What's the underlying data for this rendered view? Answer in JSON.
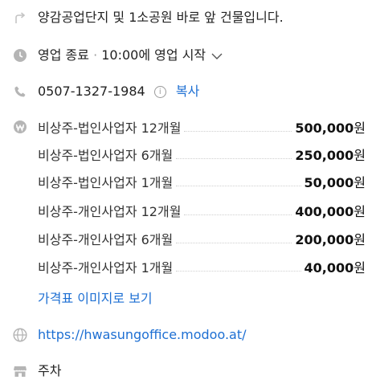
{
  "directions": {
    "text": "양감공업단지 및 1소공원 바로 앞 건물입니다.",
    "icon": "turn-arrow-icon"
  },
  "hours": {
    "status": "영업 종료",
    "separator": "·",
    "next": "10:00에 영업 시작",
    "icon": "clock-icon"
  },
  "phone": {
    "number": "0507-1327-1984",
    "info_symbol": "i",
    "copy_label": "복사",
    "icon": "phone-icon"
  },
  "prices": {
    "icon": "won-icon",
    "items": [
      {
        "name": "비상주-법인사업자 12개월",
        "amount": "500,000",
        "unit": "원"
      },
      {
        "name": "비상주-법인사업자 6개월",
        "amount": "250,000",
        "unit": "원"
      },
      {
        "name": "비상주-법인사업자 1개월",
        "amount": "50,000",
        "unit": "원"
      },
      {
        "name": "비상주-개인사업자 12개월",
        "amount": "400,000",
        "unit": "원"
      },
      {
        "name": "비상주-개인사업자 6개월",
        "amount": "200,000",
        "unit": "원"
      },
      {
        "name": "비상주-개인사업자 1개월",
        "amount": "40,000",
        "unit": "원"
      }
    ],
    "image_link": "가격표 이미지로 보기"
  },
  "website": {
    "url": "https://hwasungoffice.modoo.at/",
    "icon": "globe-icon"
  },
  "facility": {
    "label": "주차",
    "icon": "store-icon"
  },
  "colors": {
    "link": "#1d6fd3",
    "icon": "#b5b5b5",
    "text": "#222222"
  }
}
